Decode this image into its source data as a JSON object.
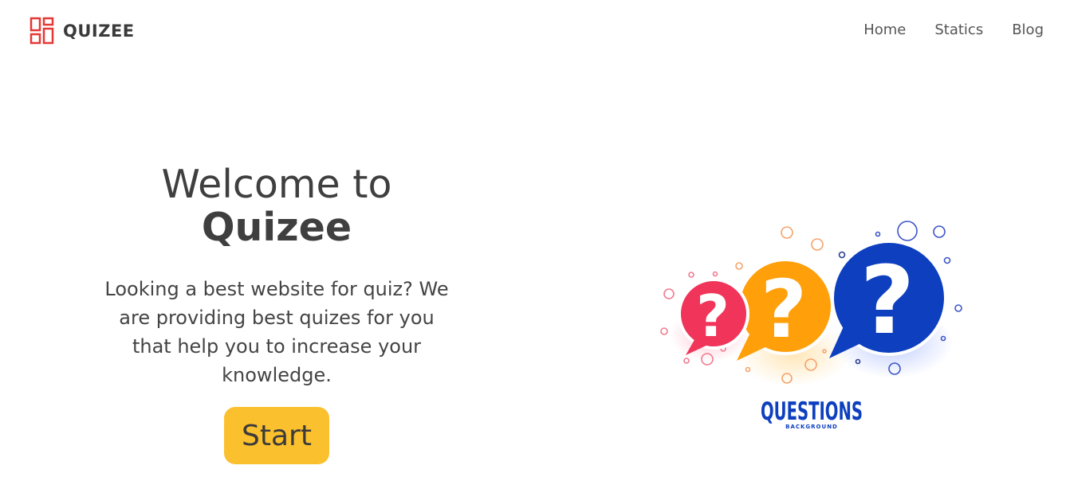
{
  "brand": {
    "name": "QUIZEE",
    "icon": "grid-logo-icon",
    "color": "#e53935"
  },
  "nav": [
    {
      "label": "Home"
    },
    {
      "label": "Statics"
    },
    {
      "label": "Blog"
    }
  ],
  "hero": {
    "title_line1": "Welcome to",
    "title_line2": "Quizee",
    "description": "Looking a best website for quiz? We are providing best quizes for you that help you to increase your knowledge.",
    "start_label": "Start",
    "button_color": "#fbc02d"
  },
  "illustration": {
    "caption": "QUESTIONS",
    "subcaption": "BACKGROUND",
    "bubble_colors": [
      "#f0345a",
      "#ff9f0a",
      "#0d3fbf"
    ]
  }
}
